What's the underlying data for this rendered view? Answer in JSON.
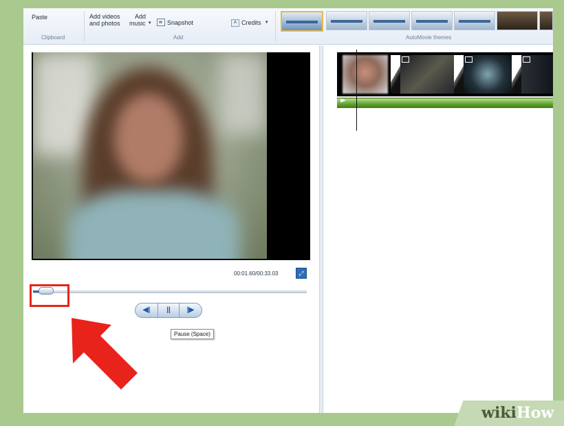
{
  "ribbon": {
    "paste_label": "Paste",
    "add_videos_label_1": "Add videos",
    "add_videos_label_2": "and photos",
    "add_music_label_1": "Add",
    "add_music_label_2": "music",
    "dropdown_arrow": "▾",
    "snapshot_label": "Snapshot",
    "credits_icon_text": "A",
    "credits_label": "Credits",
    "groups": {
      "clipboard": "Clipboard",
      "add": "Add",
      "themes": "AutoMovie themes"
    }
  },
  "player": {
    "timecode": "00:01.60/00:33.03",
    "expand_glyph": "⤢",
    "seek_position_fraction": 0.05,
    "controls": {
      "previous_frame": "◀|",
      "pause": "||",
      "next_frame": "|▶"
    },
    "tooltip": "Pause (Space)"
  },
  "watermark": {
    "part1": "wiki",
    "part2": "How"
  },
  "colors": {
    "accent": "#2f6db5",
    "highlight": "#e8231c",
    "page_bg": "#a9c98f",
    "audio_track": "#5ea12c"
  }
}
